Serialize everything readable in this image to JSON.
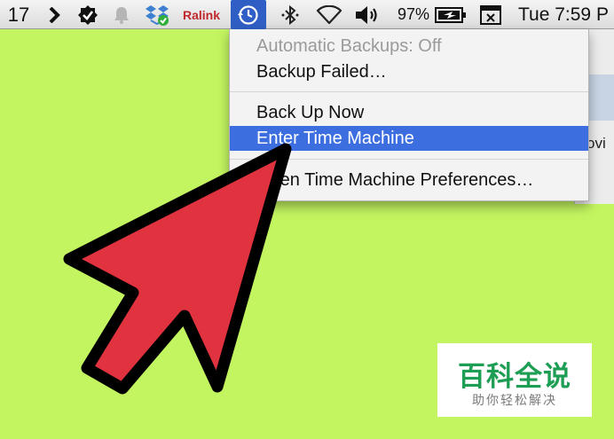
{
  "menubar": {
    "date_num": "17",
    "network_label": "Ralink",
    "battery_percent": "97%",
    "clock": "Tue 7:59 P",
    "icons": [
      "chevron-right-icon",
      "checkmark-badge-icon",
      "notification-bell-icon",
      "dropbox-icon",
      "time-machine-icon",
      "bluetooth-icon",
      "wifi-icon",
      "volume-icon",
      "battery-icon",
      "input-menu-icon"
    ]
  },
  "menu": {
    "items": [
      {
        "label": "Automatic Backups: Off",
        "enabled": false
      },
      {
        "label": "Backup Failed…",
        "enabled": true
      },
      {
        "label": "Back Up Now",
        "enabled": true
      },
      {
        "label": "Enter Time Machine",
        "enabled": true,
        "highlighted": true
      },
      {
        "label": "Open Time Machine Preferences…",
        "enabled": true
      }
    ]
  },
  "background_window": {
    "text_fragment": "ovi"
  },
  "watermark": {
    "title": "百科全说",
    "subtitle": "助你轻松解决"
  },
  "colors": {
    "background": "#c3f560",
    "highlight": "#3d6ee0",
    "arrow_fill": "#e0323f",
    "watermark_text": "#1e9e55"
  }
}
